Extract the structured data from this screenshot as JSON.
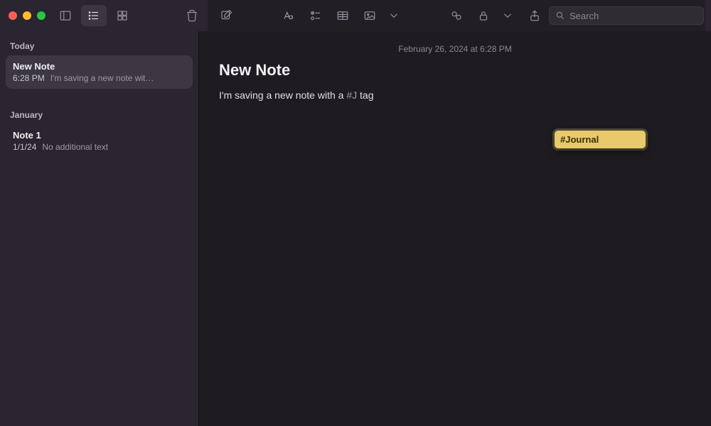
{
  "toolbar": {
    "search_placeholder": "Search"
  },
  "sidebar": {
    "sections": [
      {
        "header": "Today",
        "items": [
          {
            "title": "New Note",
            "time": "6:28 PM",
            "preview": "I'm saving a new note wit…",
            "selected": true
          }
        ]
      },
      {
        "header": "January",
        "items": [
          {
            "title": "Note 1",
            "time": "1/1/24",
            "preview": "No additional text",
            "selected": false
          }
        ]
      }
    ]
  },
  "editor": {
    "date": "February 26, 2024 at 6:28 PM",
    "title": "New Note",
    "body_plain": "I'm saving a new note with a ",
    "body_hash": "#J",
    "body_after": " tag",
    "tag_suggestion": "#Journal"
  }
}
